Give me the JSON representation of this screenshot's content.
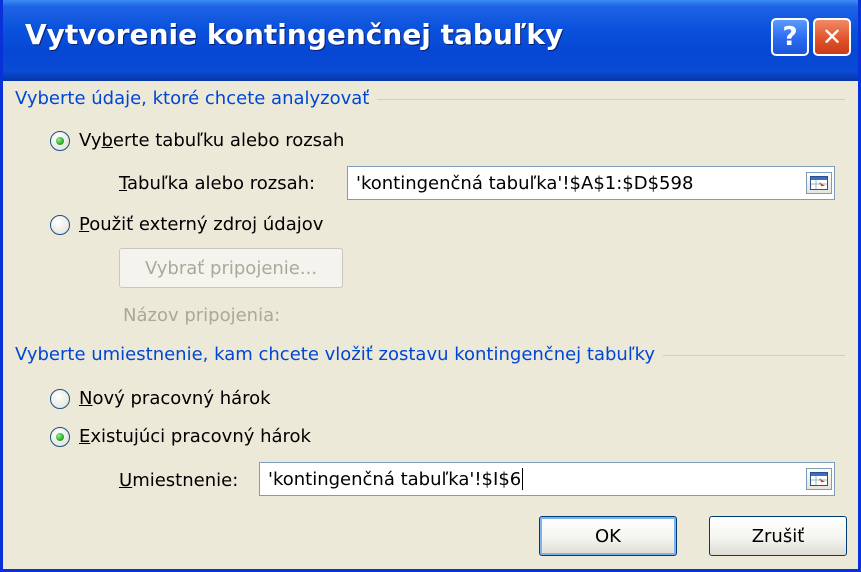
{
  "window": {
    "title": "Vytvorenie kontingenčnej tabuľky",
    "help_label": "?",
    "close_label": "✕"
  },
  "section_data": {
    "label": "Vyberte údaje, ktoré chcete analyzovať",
    "option_table": {
      "pre": "Vy",
      "accel": "b",
      "post": "erte tabuľku alebo rozsah",
      "checked": true
    },
    "range_field": {
      "accel": "T",
      "label_rest": "abuľka alebo rozsah:",
      "value": "'kontingenčná tabuľka'!$A$1:$D$598"
    },
    "option_external": {
      "accel": "P",
      "post": "oužiť externý zdroj údajov",
      "checked": false
    },
    "choose_connection_button": "Vybrať pripojenie...",
    "connection_name_label": "Názov pripojenia:"
  },
  "section_location": {
    "label": "Vyberte umiestnenie, kam chcete vložiť zostavu kontingenčnej tabuľky",
    "option_new": {
      "accel": "N",
      "post": "ový pracovný hárok",
      "checked": false
    },
    "option_existing": {
      "accel": "E",
      "post": "xistujúci pracovný hárok",
      "checked": true
    },
    "location_field": {
      "accel": "U",
      "label_rest": "miestnenie:",
      "value": "'kontingenčná tabuľka'!$I$6"
    }
  },
  "buttons": {
    "ok": "OK",
    "cancel": "Zrušiť"
  }
}
